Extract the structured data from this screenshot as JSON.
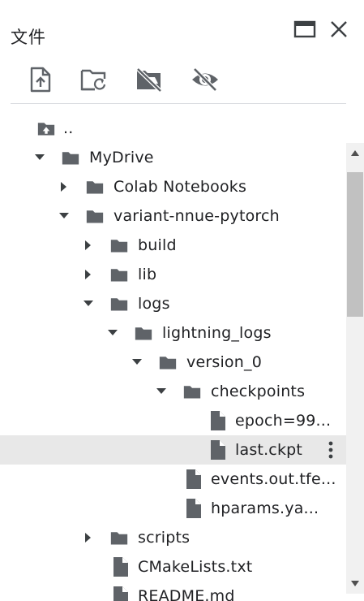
{
  "panel": {
    "title": "文件",
    "icons": {
      "maximize": "maximize-window-icon",
      "close": "close-icon"
    }
  },
  "toolbar": {
    "icons": [
      "upload-file-icon",
      "refresh-folder-icon",
      "drive-off-icon",
      "hide-hidden-files-icon"
    ]
  },
  "tree": {
    "rows": [
      {
        "name": "parent-dir",
        "label": "..",
        "type": "parent",
        "arrow": "none",
        "depth": 0
      },
      {
        "name": "mydrive",
        "label": "MyDrive",
        "type": "folder",
        "arrow": "down",
        "depth": 1
      },
      {
        "name": "colab-notebooks",
        "label": "Colab Notebooks",
        "type": "folder",
        "arrow": "right",
        "depth": 2
      },
      {
        "name": "variant-nnue-pytorch",
        "label": "variant-nnue-pytorch",
        "type": "folder",
        "arrow": "down",
        "depth": 2
      },
      {
        "name": "build",
        "label": "build",
        "type": "folder",
        "arrow": "right",
        "depth": 3
      },
      {
        "name": "lib",
        "label": "lib",
        "type": "folder",
        "arrow": "right",
        "depth": 3
      },
      {
        "name": "logs",
        "label": "logs",
        "type": "folder",
        "arrow": "down",
        "depth": 3
      },
      {
        "name": "lightning-logs",
        "label": "lightning_logs",
        "type": "folder",
        "arrow": "down",
        "depth": 4
      },
      {
        "name": "version-0",
        "label": "version_0",
        "type": "folder",
        "arrow": "down",
        "depth": 5
      },
      {
        "name": "checkpoints",
        "label": "checkpoints",
        "type": "folder",
        "arrow": "down",
        "depth": 6
      },
      {
        "name": "epoch-file",
        "label": "epoch=99...",
        "type": "file",
        "arrow": "none",
        "depth": 7
      },
      {
        "name": "last-ckpt",
        "label": "last.ckpt",
        "type": "file",
        "arrow": "none",
        "depth": 7,
        "selected": true
      },
      {
        "name": "events-file",
        "label": "events.out.tfe...",
        "type": "file",
        "arrow": "none",
        "depth": 6
      },
      {
        "name": "hparams-file",
        "label": "hparams.ya...",
        "type": "file",
        "arrow": "none",
        "depth": 6
      },
      {
        "name": "scripts",
        "label": "scripts",
        "type": "folder",
        "arrow": "right",
        "depth": 3
      },
      {
        "name": "cmakelists",
        "label": "CMakeLists.txt",
        "type": "file",
        "arrow": "none",
        "depth": 3
      },
      {
        "name": "readme",
        "label": "README.md",
        "type": "file",
        "arrow": "none",
        "depth": 3
      }
    ]
  },
  "colors": {
    "icon": "#5f6368",
    "selected_row": "#e8e8e8",
    "scroll_thumb": "#c1c1c1"
  }
}
